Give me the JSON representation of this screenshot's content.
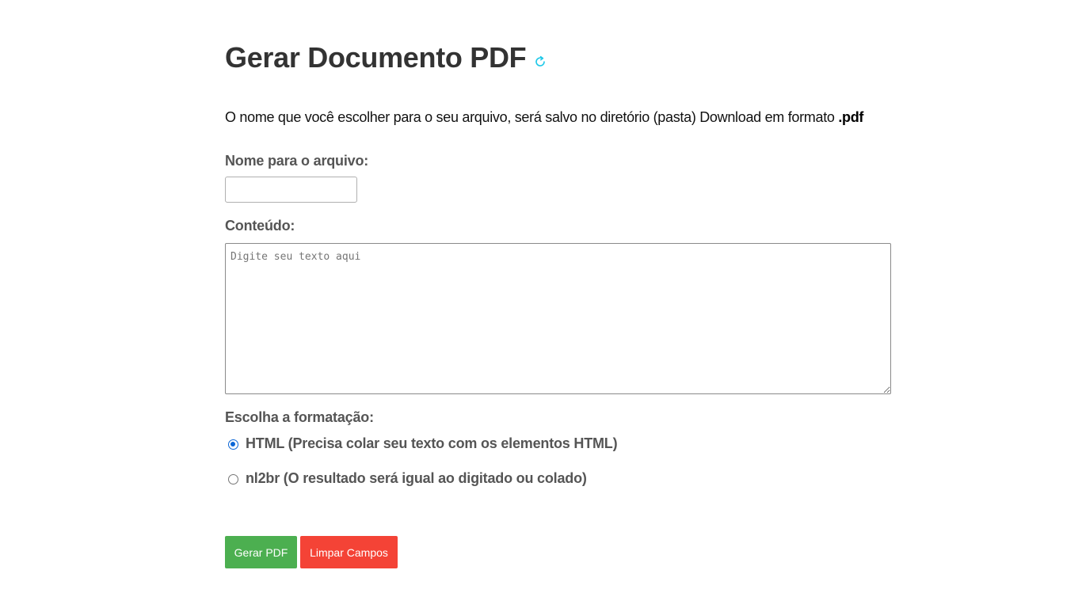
{
  "header": {
    "title": "Gerar Documento PDF",
    "refresh_icon": "refresh-icon",
    "refresh_icon_color": "#1ec8e8"
  },
  "intro": {
    "text": "O nome que você escolher para o seu arquivo, será salvo no diretório (pasta) Download em formato ",
    "highlight": ".pdf"
  },
  "form": {
    "filename_label": "Nome para o arquivo:",
    "filename_value": "",
    "content_label": "Conteúdo:",
    "content_placeholder": "Digite seu texto aqui",
    "content_value": "",
    "format_label": "Escolha a formatação:",
    "format_options": [
      {
        "label": "HTML (Precisa colar seu texto com os elementos HTML)",
        "selected": true
      },
      {
        "label": "nl2br (O resultado será igual ao digitado ou colado)",
        "selected": false
      }
    ]
  },
  "actions": {
    "generate_label": "Gerar PDF",
    "generate_color": "#4caf50",
    "clear_label": "Limpar Campos",
    "clear_color": "#f44336"
  }
}
